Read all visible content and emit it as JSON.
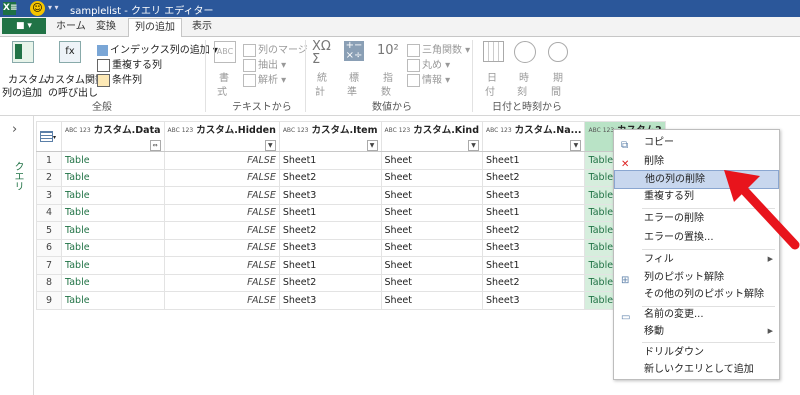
{
  "titlebar": {
    "app_icon": "X≡",
    "title": "samplelist - クエリ エディター"
  },
  "tabs": {
    "file": "■ ▾",
    "items": [
      "ホーム",
      "変換",
      "列の追加",
      "表示"
    ],
    "active_index": 2
  },
  "ribbon": {
    "general": {
      "custom_column": [
        "カスタム",
        "列の追加"
      ],
      "invoke_function": [
        "カスタム関数",
        "の呼び出し"
      ],
      "index_column": "インデックス列の追加",
      "duplicate_column": "重複する列",
      "conditional_column": "条件列",
      "group": "全般"
    },
    "text": {
      "format": [
        "書",
        "式"
      ],
      "merge_columns": "列のマージ",
      "extract": "抽出",
      "parse": "解析",
      "group": "テキストから"
    },
    "number": {
      "statistics": [
        "統",
        "計"
      ],
      "standard": [
        "標",
        "準"
      ],
      "scientific": [
        "指",
        "数"
      ],
      "trigonometry": "三角関数",
      "rounding": "丸め",
      "information": "情報",
      "group": "数値から"
    },
    "datetime": {
      "date": [
        "日",
        "付"
      ],
      "time": [
        "時",
        "刻"
      ],
      "duration": [
        "期",
        "間"
      ],
      "group": "日付と時刻から"
    }
  },
  "left_pane": {
    "label": "クエリ"
  },
  "grid": {
    "type_badge": "ABC 123",
    "columns": [
      "カスタム.Data",
      "カスタム.Hidden",
      "カスタム.Item",
      "カスタム.Kind",
      "カスタム.Na...",
      "カスタム2"
    ],
    "rows": [
      [
        "1",
        "Table",
        "FALSE",
        "Sheet1",
        "Sheet",
        "Sheet1",
        "Table"
      ],
      [
        "2",
        "Table",
        "FALSE",
        "Sheet2",
        "Sheet",
        "Sheet2",
        "Table"
      ],
      [
        "3",
        "Table",
        "FALSE",
        "Sheet3",
        "Sheet",
        "Sheet3",
        "Table"
      ],
      [
        "4",
        "Table",
        "FALSE",
        "Sheet1",
        "Sheet",
        "Sheet1",
        "Table"
      ],
      [
        "5",
        "Table",
        "FALSE",
        "Sheet2",
        "Sheet",
        "Sheet2",
        "Table"
      ],
      [
        "6",
        "Table",
        "FALSE",
        "Sheet3",
        "Sheet",
        "Sheet3",
        "Table"
      ],
      [
        "7",
        "Table",
        "FALSE",
        "Sheet1",
        "Sheet",
        "Sheet1",
        "Table"
      ],
      [
        "8",
        "Table",
        "FALSE",
        "Sheet2",
        "Sheet",
        "Sheet2",
        "Table"
      ],
      [
        "9",
        "Table",
        "FALSE",
        "Sheet3",
        "Sheet",
        "Sheet3",
        "Table"
      ]
    ]
  },
  "context_menu": {
    "items": [
      "コピー",
      "削除",
      "他の列の削除",
      "重複する列",
      "エラーの削除",
      "エラーの置換...",
      "フィル",
      "列のピボット解除",
      "その他の列のピボット解除",
      "名前の変更...",
      "移動",
      "ドリルダウン",
      "新しいクエリとして追加"
    ],
    "highlighted": "他の列の削除"
  },
  "colors": {
    "accent": "#217346",
    "selection": "#d6eedd",
    "menu_highlight": "#c8d7ee",
    "arrow": "#e8141c"
  }
}
